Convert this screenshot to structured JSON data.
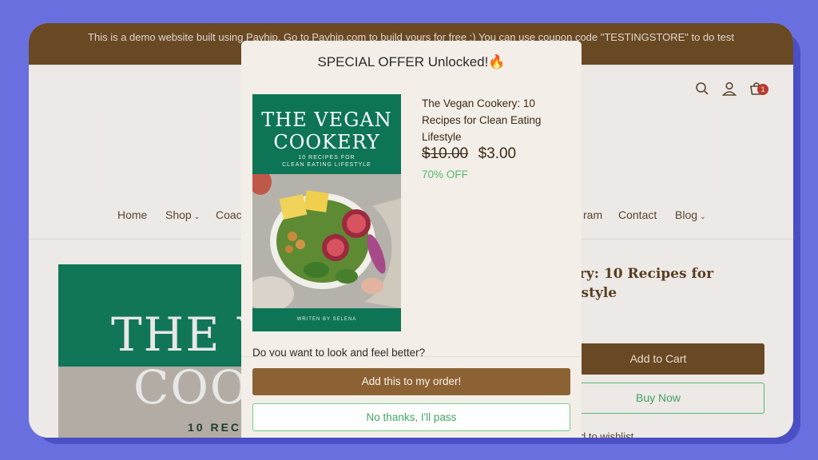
{
  "banner": {
    "text": "This is a demo website built using Payhip. Go to Payhip.com to build yours for free :) You can use coupon code \"TESTINGSTORE\" to do test"
  },
  "header": {
    "icons": [
      "search-icon",
      "user-icon",
      "cart-icon"
    ],
    "cart_count": "1"
  },
  "nav": {
    "items": [
      {
        "label": "Home"
      },
      {
        "label": "Shop",
        "has_dropdown": true
      },
      {
        "label": "Coac"
      },
      {
        "label": "ram"
      },
      {
        "label": "Contact"
      },
      {
        "label": "Blog",
        "has_dropdown": true
      }
    ]
  },
  "product_page": {
    "hero_title_line1": "THE V",
    "hero_title_line2": "COO",
    "hero_subtitle": "10 RECI",
    "title_line1": "okery: 10 Recipes for",
    "title_line2": "Lifestyle",
    "add_to_cart_label": "Add to Cart",
    "buy_now_label": "Buy Now",
    "wishlist_label": "d to wishlist"
  },
  "modal": {
    "title": "SPECIAL OFFER Unlocked!🔥",
    "cover": {
      "title_line1": "THE VEGAN",
      "title_line2": "COOKERY",
      "subtitle_line1": "10 RECIPES FOR",
      "subtitle_line2": "CLEAN EATING LIFESTYLE",
      "footer": "WRITEN BY SELENA"
    },
    "product_name": "The Vegan Cookery: 10 Recipes for Clean Eating Lifestyle",
    "old_price": "$10.00",
    "new_price": "$3.00",
    "discount": "70% OFF",
    "question": "Do you want to look and feel better?",
    "accept_label": "Add this to my order!",
    "decline_label": "No thanks, I'll pass"
  },
  "colors": {
    "page_bg": "#6a6fe0",
    "banner_bg": "#6b4a22",
    "accent_brown": "#8c6234",
    "accent_green": "#55b96f",
    "cover_green": "#0d7556"
  }
}
